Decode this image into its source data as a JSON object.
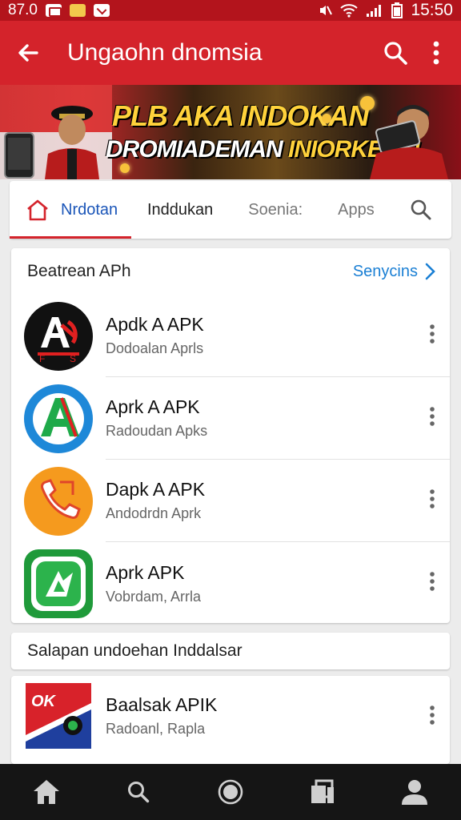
{
  "status_bar": {
    "left_text": "87.0",
    "time": "15:50"
  },
  "app_bar": {
    "title": "Ungaohn dnomsia",
    "icons": [
      "back-arrow-icon",
      "search-icon",
      "more-vert-icon"
    ]
  },
  "banner": {
    "line1": "PLB AKA INDOKAN",
    "line2_main": "DROMIADEMAN ",
    "line2_highlight": "INIORKESS!"
  },
  "tabs": {
    "items": [
      {
        "label": "Nrdotan",
        "active": true
      },
      {
        "label": "Inddukan"
      },
      {
        "label": "Soenia:"
      },
      {
        "label": "Apps"
      }
    ]
  },
  "main_section": {
    "title": "Beatrean APh",
    "link_label": "Senycins",
    "apps": [
      {
        "name": "Apdk A APK",
        "subtitle": "Dodoalan Aprls",
        "icon": "black-red-a-logo-icon"
      },
      {
        "name": "Aprk A APK",
        "subtitle": "Radoudan Apks",
        "icon": "blue-green-a-logo-icon"
      },
      {
        "name": "Dapk A APK",
        "subtitle": "Andodrdn Aprk",
        "icon": "orange-phone-logo-icon"
      },
      {
        "name": "Aprk APK",
        "subtitle": "Vobrdam, Arrla",
        "icon": "green-play-logo-icon"
      }
    ]
  },
  "section2": {
    "title": "Salapan undoehan Inddalsar"
  },
  "section3": {
    "apps": [
      {
        "name": "Baalsak APIK",
        "subtitle": "Radoanl, Rapla",
        "icon": "red-blue-brand-logo-icon"
      }
    ]
  },
  "bottom_nav": {
    "items": [
      "home-icon",
      "search-icon",
      "record-icon",
      "library-icon",
      "profile-icon"
    ]
  },
  "colors": {
    "status_bar": "#b3141c",
    "app_bar": "#d4232b",
    "tab_active_text": "#1a55b8",
    "link": "#1a7fd4",
    "bottom_nav": "#151515"
  }
}
